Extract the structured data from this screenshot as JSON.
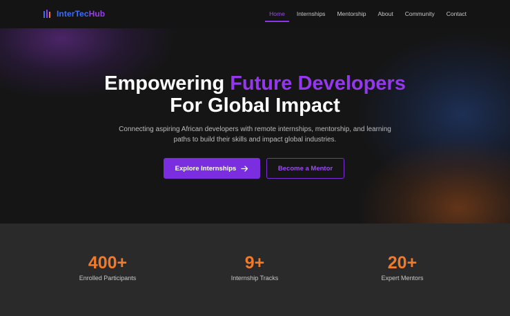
{
  "brand": {
    "name_part1": "InterTec",
    "name_part2": "Hub",
    "icon": "code-bars-icon"
  },
  "nav": {
    "items": [
      {
        "label": "Home",
        "active": true
      },
      {
        "label": "Internships",
        "active": false
      },
      {
        "label": "Mentorship",
        "active": false
      },
      {
        "label": "About",
        "active": false
      },
      {
        "label": "Community",
        "active": false
      },
      {
        "label": "Contact",
        "active": false
      }
    ]
  },
  "hero": {
    "title_part1": "Empowering ",
    "title_highlight": "Future Developers",
    "title_line2": "For Global Impact",
    "subtitle": "Connecting aspiring African developers with remote internships, mentorship, and learning paths to build their skills and impact global industries.",
    "primary_button": "Explore Internships",
    "primary_icon": "arrow-right-icon",
    "secondary_button": "Become a Mentor"
  },
  "stats": [
    {
      "value": "400+",
      "label": "Enrolled Participants"
    },
    {
      "value": "9+",
      "label": "Internship Tracks"
    },
    {
      "value": "20+",
      "label": "Expert Mentors"
    }
  ],
  "colors": {
    "accent_purple": "#7a2ee0",
    "accent_blue": "#3b6cf6",
    "stat_orange": "#f07a2a",
    "background": "#151516"
  }
}
